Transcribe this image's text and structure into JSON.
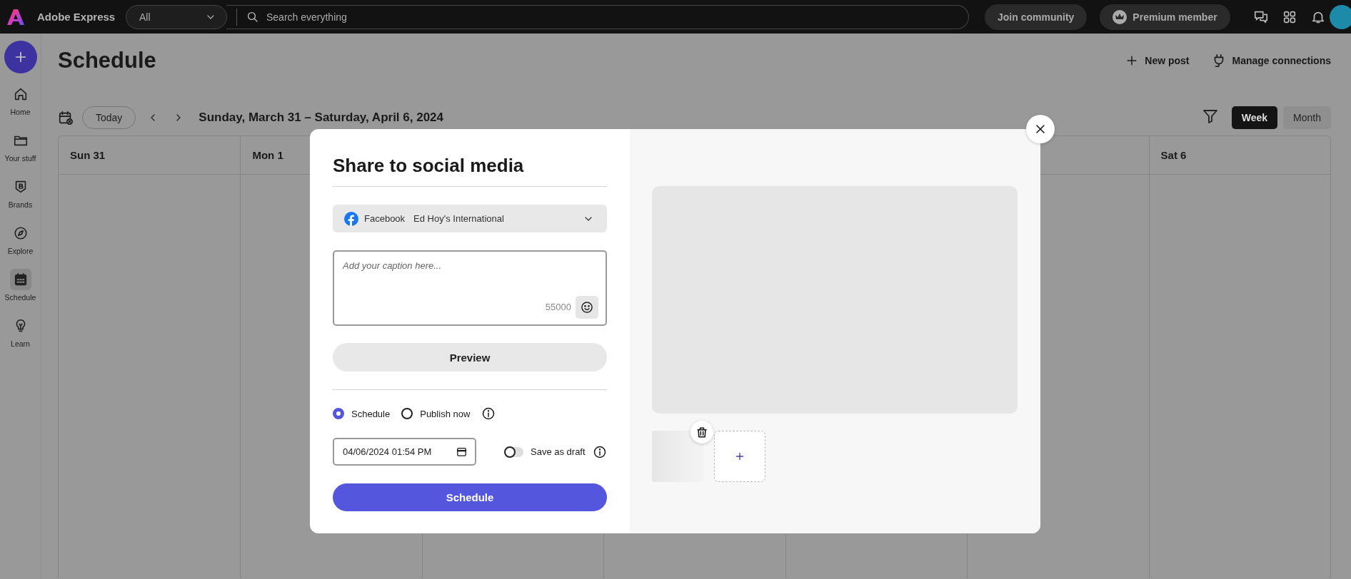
{
  "app": {
    "name": "Adobe Express"
  },
  "top_bar": {
    "scope_dropdown": "All",
    "search": {
      "placeholder": "Search everything"
    },
    "buttons": [
      "Join community",
      "Premium member"
    ]
  },
  "sidebar": {
    "items": [
      {
        "label": "Home",
        "selected": false
      },
      {
        "label": "Your stuff",
        "selected": false
      },
      {
        "label": "Brands",
        "selected": false
      },
      {
        "label": "Explore",
        "selected": false
      },
      {
        "label": "Schedule",
        "selected": true
      },
      {
        "label": "Learn",
        "selected": false
      }
    ]
  },
  "page": {
    "title": "Schedule",
    "actions": [
      "New post",
      "Manage connections"
    ]
  },
  "toolbar": {
    "today": "Today",
    "range": "Sunday, March 31 – Saturday, April 6, 2024",
    "views": [
      {
        "label": "Week",
        "selected": true
      },
      {
        "label": "Month",
        "selected": false
      }
    ]
  },
  "calendar": {
    "leading_days": [
      "Sun 31",
      "Mon 1"
    ],
    "trailing_days": [
      "Sat 6"
    ]
  },
  "modal": {
    "title": "Share to social media",
    "account": {
      "network": "Facebook",
      "name": "Ed Hoy's International"
    },
    "caption": {
      "placeholder": "Add your caption here...",
      "counter": "55000"
    },
    "preview_button": "Preview",
    "publish_options": [
      {
        "label": "Schedule",
        "selected": true
      },
      {
        "label": "Publish now",
        "selected": false
      }
    ],
    "datetime": "04/06/2024 01:54 PM",
    "save_as_draft": {
      "label": "Save as draft",
      "on": false
    },
    "submit": "Schedule"
  }
}
